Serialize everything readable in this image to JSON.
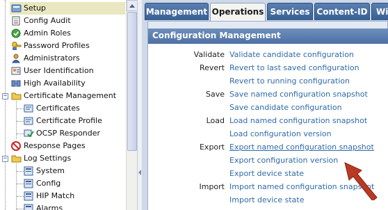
{
  "tree": {
    "items": [
      {
        "label": "Setup",
        "selected": true,
        "icon": "wrench-icon"
      },
      {
        "label": "Config Audit",
        "icon": "audit-icon"
      },
      {
        "label": "Admin Roles",
        "icon": "admin-roles-icon"
      },
      {
        "label": "Password Profiles",
        "icon": "password-icon"
      },
      {
        "label": "Administrators",
        "icon": "user-icon"
      },
      {
        "label": "User Identification",
        "icon": "user-id-icon"
      },
      {
        "label": "High Availability",
        "icon": "ha-icon"
      },
      {
        "label": "Certificate Management",
        "icon": "folder-icon"
      },
      {
        "label": "Certificates",
        "icon": "certificate-icon"
      },
      {
        "label": "Certificate Profile",
        "icon": "certificate-profile-icon"
      },
      {
        "label": "OCSP Responder",
        "icon": "ocsp-icon"
      },
      {
        "label": "Response Pages",
        "icon": "response-pages-icon"
      },
      {
        "label": "Log Settings",
        "icon": "folder-icon"
      },
      {
        "label": "System",
        "icon": "log-icon"
      },
      {
        "label": "Config",
        "icon": "log-icon"
      },
      {
        "label": "HIP Match",
        "icon": "log-icon"
      },
      {
        "label": "Alarms",
        "icon": "log-icon"
      }
    ]
  },
  "tabs": [
    {
      "label": "Management",
      "active": false
    },
    {
      "label": "Operations",
      "active": true
    },
    {
      "label": "Services",
      "active": false
    },
    {
      "label": "Content-ID",
      "active": false
    },
    {
      "label": "Wi",
      "active": false
    }
  ],
  "panel": {
    "title": "Configuration Management",
    "rows": [
      {
        "category": "Validate",
        "link": "Validate candidate configuration"
      },
      {
        "category": "Revert",
        "link": "Revert to last saved configuration"
      },
      {
        "category": "",
        "link": "Revert to running configuration"
      },
      {
        "category": "Save",
        "link": "Save named configuration snapshot"
      },
      {
        "category": "",
        "link": "Save candidate configuration"
      },
      {
        "category": "Load",
        "link": "Load named configuration snapshot"
      },
      {
        "category": "",
        "link": "Load configuration version"
      },
      {
        "category": "Export",
        "link": "Export named configuration snapshot",
        "hovered": true
      },
      {
        "category": "",
        "link": "Export configuration version"
      },
      {
        "category": "",
        "link": "Export device state"
      },
      {
        "category": "Import",
        "link": "Import named configuration snapshot"
      },
      {
        "category": "",
        "link": "Import device state"
      }
    ]
  },
  "colors": {
    "tab_blue": "#4a6fa3",
    "link_blue": "#2f6aa8",
    "arrow_red": "#b83a22",
    "selected_bg": "#e8e7c0"
  }
}
